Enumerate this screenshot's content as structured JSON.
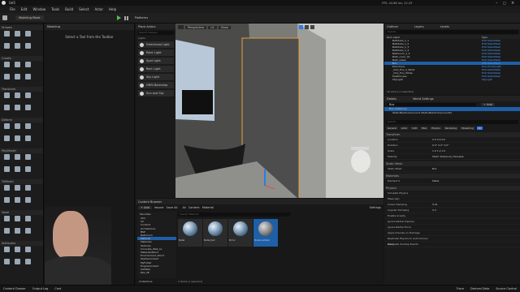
{
  "window": {
    "title": "Ue5",
    "project": "Modeling Mode",
    "stats": "FPS: 44.86 ms: 22.29",
    "extra": "SPD 1.0"
  },
  "menu": [
    "File",
    "Edit",
    "Window",
    "Tools",
    "Build",
    "Select",
    "Actor",
    "Help"
  ],
  "toolbar": {
    "mode_label": "Modeling Mode",
    "platforms": "Platforms"
  },
  "mode_panel": {
    "message": "Select a Tool from the Toolbar"
  },
  "place_actors": {
    "title": "Place Actors",
    "search_placeholder": "Search Classes",
    "category": "Lights",
    "items": [
      "Directional Light",
      "Point Light",
      "Spot Light",
      "Rect Light",
      "Sky Light",
      "HDRI Backdrop",
      "Sun and Sky"
    ]
  },
  "viewport": {
    "perspective": "Perspective",
    "lit": "Lit",
    "show": "Show",
    "snap": "10",
    "rot": "10°",
    "scale": "0.25",
    "cam": "4"
  },
  "outliner": {
    "title": "Outliner",
    "layers": "Layers",
    "levels": "Levels",
    "search_placeholder": "Search...",
    "col_label": "Item Label",
    "col_type": "Type",
    "count": "16 actors (1 selected)",
    "rows": [
      {
        "label": "Bathtubs_1_1",
        "type": "Edit StaticMesh"
      },
      {
        "label": "Bathtubs_1_2",
        "type": "Edit StaticMesh"
      },
      {
        "label": "Bathtubs_1_3",
        "type": "Edit StaticMesh"
      },
      {
        "label": "Bathtubs_1_4",
        "type": "Edit StaticMesh"
      },
      {
        "label": "Bathroom_1_5",
        "type": "Edit StaticMesh"
      },
      {
        "label": "Bath_room_01",
        "type": "Edit StaticMesh"
      },
      {
        "label": "Bath_Glass",
        "type": "Edit StaticMesh"
      },
      {
        "label": "Box",
        "type": "Edit StaticMesh"
      },
      {
        "label": "Directions",
        "type": "DirectionalLight"
      },
      {
        "label": "_Dirs_Env_1_What",
        "type": "Edit StaticMesh"
      },
      {
        "label": "_Dirs_Env_White",
        "type": "Edit StaticMesh"
      },
      {
        "label": "PostProcess",
        "type": "Edit StaticMesh"
      },
      {
        "label": "SkyLight",
        "type": "SkyLight"
      }
    ]
  },
  "details": {
    "title": "Details",
    "world": "World Settings",
    "actor": "Box",
    "add": "+ Add",
    "component": "Box (Instance)",
    "subcomponent": "StaticMeshComponent (StaticMeshComponent0)",
    "search_placeholder": "Search",
    "filters": [
      "General",
      "Actor",
      "LOD",
      "Misc",
      "Physics",
      "Rendering",
      "Streaming",
      "All"
    ],
    "sections": [
      {
        "name": "Transform"
      },
      {
        "name": "Static Mesh"
      },
      {
        "name": "Materials"
      },
      {
        "name": "Physics"
      },
      {
        "name": "Collision"
      }
    ],
    "props": [
      {
        "k": "Location",
        "v": "0.0  0.0  0.0"
      },
      {
        "k": "Rotation",
        "v": "0.0°  0.0°  0.0°"
      },
      {
        "k": "Scale",
        "v": "1.0  1.0  1.0"
      },
      {
        "k": "Mobility",
        "v": "Static  Stationary  Movable"
      },
      {
        "k": "Static Mesh",
        "v": "Box"
      },
      {
        "k": "Element 0",
        "v": "Metal"
      },
      {
        "k": "Simulate Physics",
        "v": ""
      },
      {
        "k": "Mass (kg)",
        "v": ""
      },
      {
        "k": "Linear Damping",
        "v": "0.01"
      },
      {
        "k": "Angular Damping",
        "v": "0.0"
      },
      {
        "k": "Enable Gravity",
        "v": ""
      },
      {
        "k": "Ignore Radial Impulse",
        "v": ""
      },
      {
        "k": "Ignore Radial Force",
        "v": ""
      },
      {
        "k": "Apply Impulse on Damage",
        "v": ""
      },
      {
        "k": "Replicate Physics to Autonomous Proxy",
        "v": ""
      },
      {
        "k": "Generate Overlap Events",
        "v": ""
      }
    ]
  },
  "content_browser": {
    "title": "Content Browser",
    "add": "+ Add",
    "import": "Import",
    "save_all": "Save All",
    "path": [
      "All",
      "Content",
      "Material"
    ],
    "settings": "Settings",
    "search_placeholder": "Search Material",
    "favorites": "Favorites",
    "collections": "Collections",
    "footer": "4 items (1 selected)",
    "tree": [
      "Vtol",
      "All",
      "Content",
      "Architecture",
      "BSP",
      "Bathroom",
      "Material",
      "Materials",
      "Textures",
      "Concrete_Wall_ao",
      "MaterialsWood",
      "Environment_Wood",
      "StarterContent",
      "MyFolder",
      "EngineContent",
      "Ue5Test",
      "Res_UE"
    ],
    "assets": [
      "Metal",
      "Metal_Red",
      "Mirror",
      "Material-Metal"
    ]
  },
  "status": {
    "content_drawer": "Content Drawer",
    "output_log": "Output Log",
    "cmd": "Cmd",
    "trace": "Trace",
    "derived": "Derived Data",
    "source": "Source Control"
  },
  "colors": {
    "accent": "#2b7de9",
    "select": "#1e5fa8",
    "orange": "#e8a03a"
  }
}
